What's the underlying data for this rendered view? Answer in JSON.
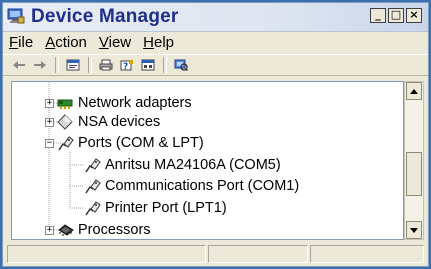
{
  "window": {
    "title": "Device Manager",
    "caption_buttons": {
      "minimize": "_",
      "maximize": "□",
      "close": "×"
    }
  },
  "menu": [
    {
      "label": "File",
      "accel": "F",
      "rest": "ile"
    },
    {
      "label": "Action",
      "accel": "A",
      "rest": "ction"
    },
    {
      "label": "View",
      "accel": "V",
      "rest": "iew"
    },
    {
      "label": "Help",
      "accel": "H",
      "rest": "elp"
    }
  ],
  "toolbar": {
    "icons": [
      "back-icon",
      "forward-icon",
      "properties-icon",
      "print-icon",
      "help-icon",
      "view-icon",
      "scan-hardware-icon"
    ]
  },
  "tree": {
    "items": [
      {
        "label": "Network adapters",
        "state": "collapsed",
        "icon": "network-adapter-icon"
      },
      {
        "label": "NSA devices",
        "state": "collapsed",
        "icon": "diamond-device-icon"
      },
      {
        "label": "Ports (COM & LPT)",
        "state": "expanded",
        "icon": "port-connector-icon"
      },
      {
        "label": "Anritsu MA24106A (COM5)",
        "state": "leaf",
        "icon": "port-connector-icon"
      },
      {
        "label": "Communications Port (COM1)",
        "state": "leaf",
        "icon": "port-connector-icon"
      },
      {
        "label": "Printer Port (LPT1)",
        "state": "leaf",
        "icon": "port-connector-icon"
      },
      {
        "label": "Processors",
        "state": "collapsed",
        "icon": "processor-chip-icon"
      }
    ]
  },
  "colors": {
    "title_text": "#1e2e8f",
    "window_bg": "#ece9d8",
    "desktop": "#3a6fb2"
  }
}
